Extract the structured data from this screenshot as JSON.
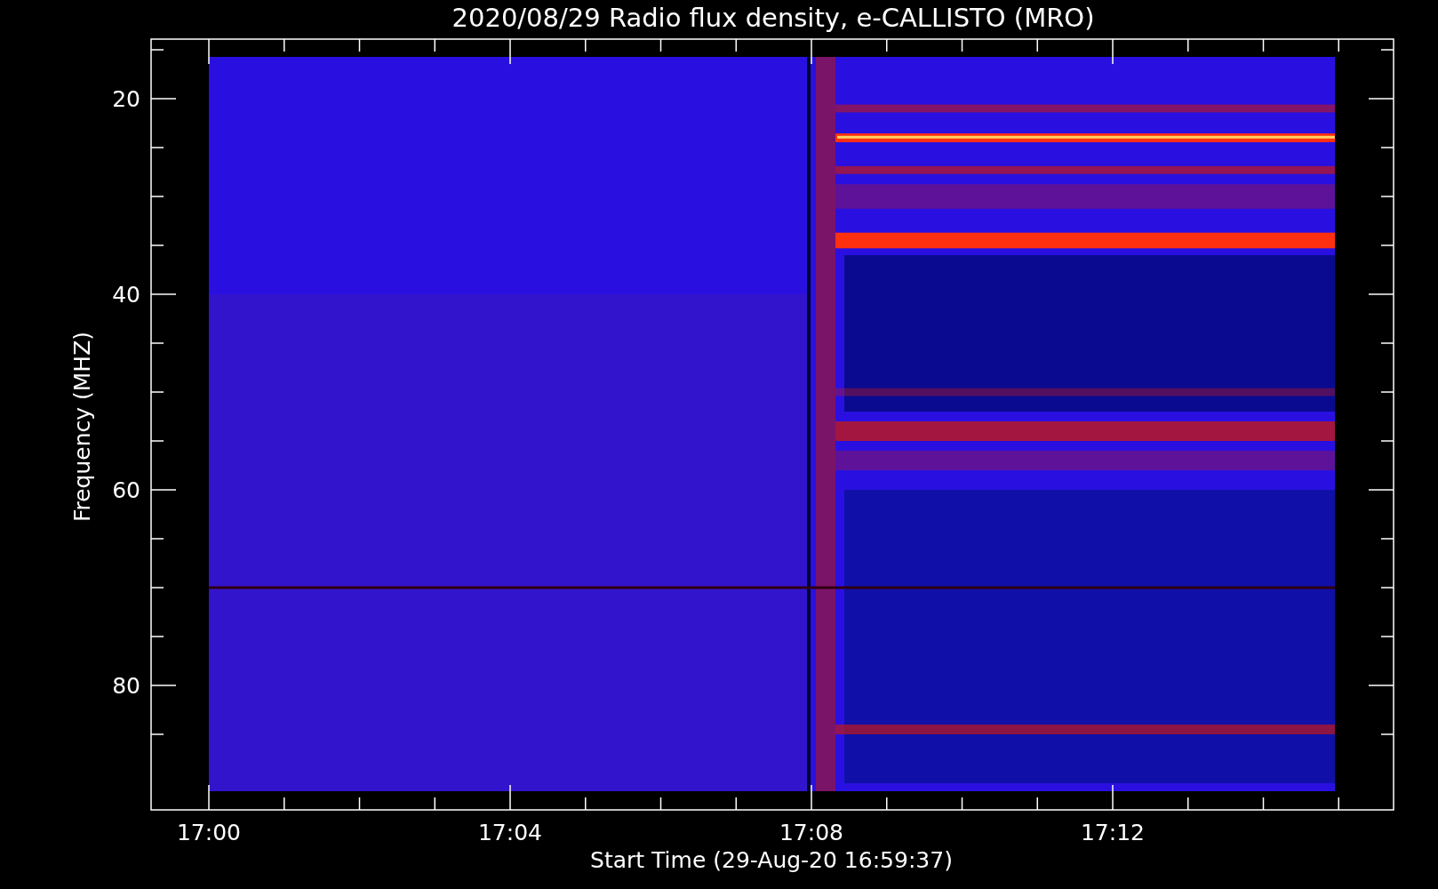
{
  "title": "2020/08/29  Radio flux density, e-CALLISTO (MRO)",
  "plot": {
    "xlabel": "Start Time (29-Aug-20 16:59:37)",
    "ylabel": "Frequency (MHZ)",
    "yticks": [
      "20",
      "40",
      "60",
      "80"
    ],
    "xticks": [
      "17:00",
      "17:04",
      "17:08",
      "17:12"
    ]
  }
}
